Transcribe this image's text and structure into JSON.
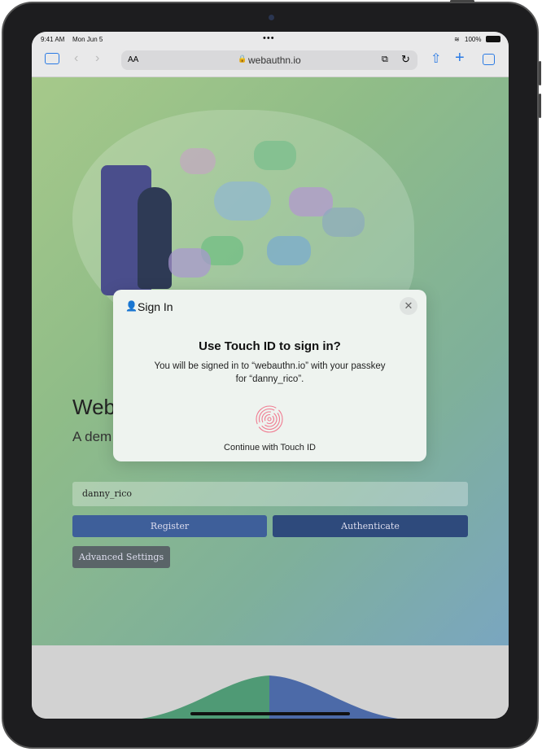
{
  "status": {
    "time": "9:41 AM",
    "date": "Mon Jun 5",
    "battery": "100%"
  },
  "browser": {
    "text_size": "AA",
    "url": "webauthn.io",
    "icons": [
      "sidebar-icon",
      "back-icon",
      "forward-icon",
      "lock-icon",
      "extension-icon",
      "reload-icon",
      "share-icon",
      "new-tab-icon",
      "tabs-icon"
    ]
  },
  "page": {
    "title": "Web",
    "subtitle": "A dem",
    "username": "danny_rico",
    "register": "Register",
    "authenticate": "Authenticate",
    "advanced": "Advanced Settings",
    "colors": {
      "register": "#3e5f9a",
      "authenticate": "#2e4a7c",
      "advanced": "#5a6468"
    }
  },
  "dialog": {
    "header": "Sign In",
    "heading": "Use Touch ID to sign in?",
    "message_line1": "You will be signed in to “webauthn.io” with your passkey",
    "message_line2": "for “danny_rico”.",
    "action": "Continue with Touch ID",
    "fingerprint_color": "#f07a90"
  }
}
